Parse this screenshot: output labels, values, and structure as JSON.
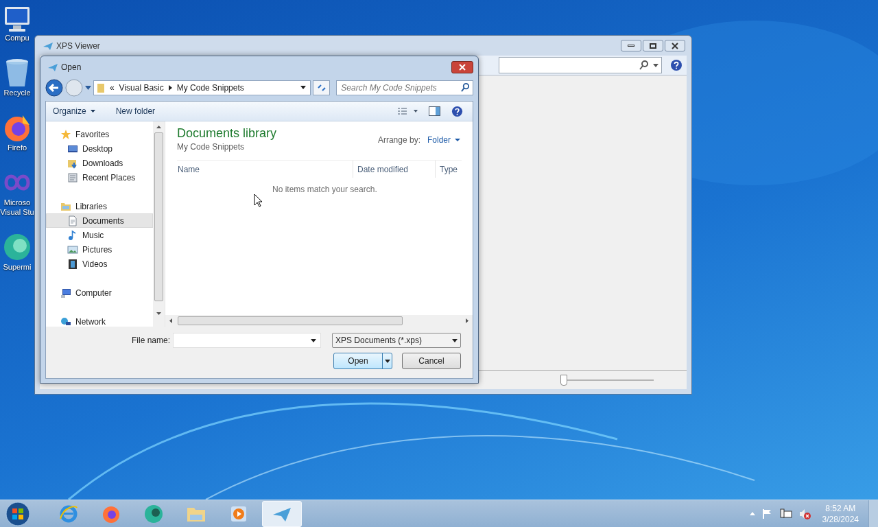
{
  "desktop_icons": [
    {
      "kind": "computer",
      "lines": [
        "Compu"
      ]
    },
    {
      "kind": "recycle-bin",
      "lines": [
        "Recycle"
      ]
    },
    {
      "kind": "browser",
      "lines": [
        "Firefo"
      ]
    },
    {
      "kind": "ide",
      "lines": [
        "Microso",
        "Visual Stu"
      ]
    },
    {
      "kind": "app",
      "lines": [
        "Supermi"
      ]
    }
  ],
  "xps_window": {
    "title": "XPS Viewer",
    "zoom_slider": {
      "level": 0.04
    }
  },
  "open_dialog": {
    "title": "Open",
    "overflow_marker": "«",
    "breadcrumb": [
      "Visual Basic",
      "My Code Snippets"
    ],
    "search": {
      "placeholder": "Search My Code Snippets"
    },
    "toolbar": [
      "Organize",
      "New folder"
    ],
    "nav": [
      {
        "kind": "star",
        "label": "Favorites",
        "selected": false,
        "children": [
          {
            "kind": "desktop",
            "label": "Desktop",
            "selected": false
          },
          {
            "kind": "downloads",
            "label": "Downloads",
            "selected": false
          },
          {
            "kind": "recent",
            "label": "Recent Places",
            "selected": false
          }
        ]
      },
      {
        "kind": "libraries",
        "label": "Libraries",
        "selected": false,
        "children": [
          {
            "kind": "document",
            "label": "Documents",
            "selected": true
          },
          {
            "kind": "music",
            "label": "Music",
            "selected": false
          },
          {
            "kind": "pictures",
            "label": "Pictures",
            "selected": false
          },
          {
            "kind": "videos",
            "label": "Videos",
            "selected": false
          }
        ]
      },
      {
        "kind": "computer",
        "label": "Computer",
        "selected": false
      },
      {
        "kind": "network",
        "label": "Network",
        "selected": false
      }
    ],
    "heading": "Documents library",
    "subheading": "My Code Snippets",
    "arrange_label": "Arrange by:",
    "arrange_value": "Folder",
    "columns": [
      "Name",
      "Date modified",
      "Type"
    ],
    "empty_message": "No items match your search.",
    "file_name_label": "File name:",
    "file_type": "XPS Documents (*.xps)",
    "buttons": [
      "Open",
      "Cancel"
    ]
  },
  "taskbar": {
    "items": [
      {
        "kind": "ie",
        "selected": false
      },
      {
        "kind": "firefox",
        "selected": false
      },
      {
        "kind": "app",
        "selected": false
      },
      {
        "kind": "explorer",
        "selected": false
      },
      {
        "kind": "media",
        "selected": false
      },
      {
        "kind": "xps",
        "selected": true
      }
    ],
    "time": "8:52 AM",
    "date": "3/28/2024"
  }
}
